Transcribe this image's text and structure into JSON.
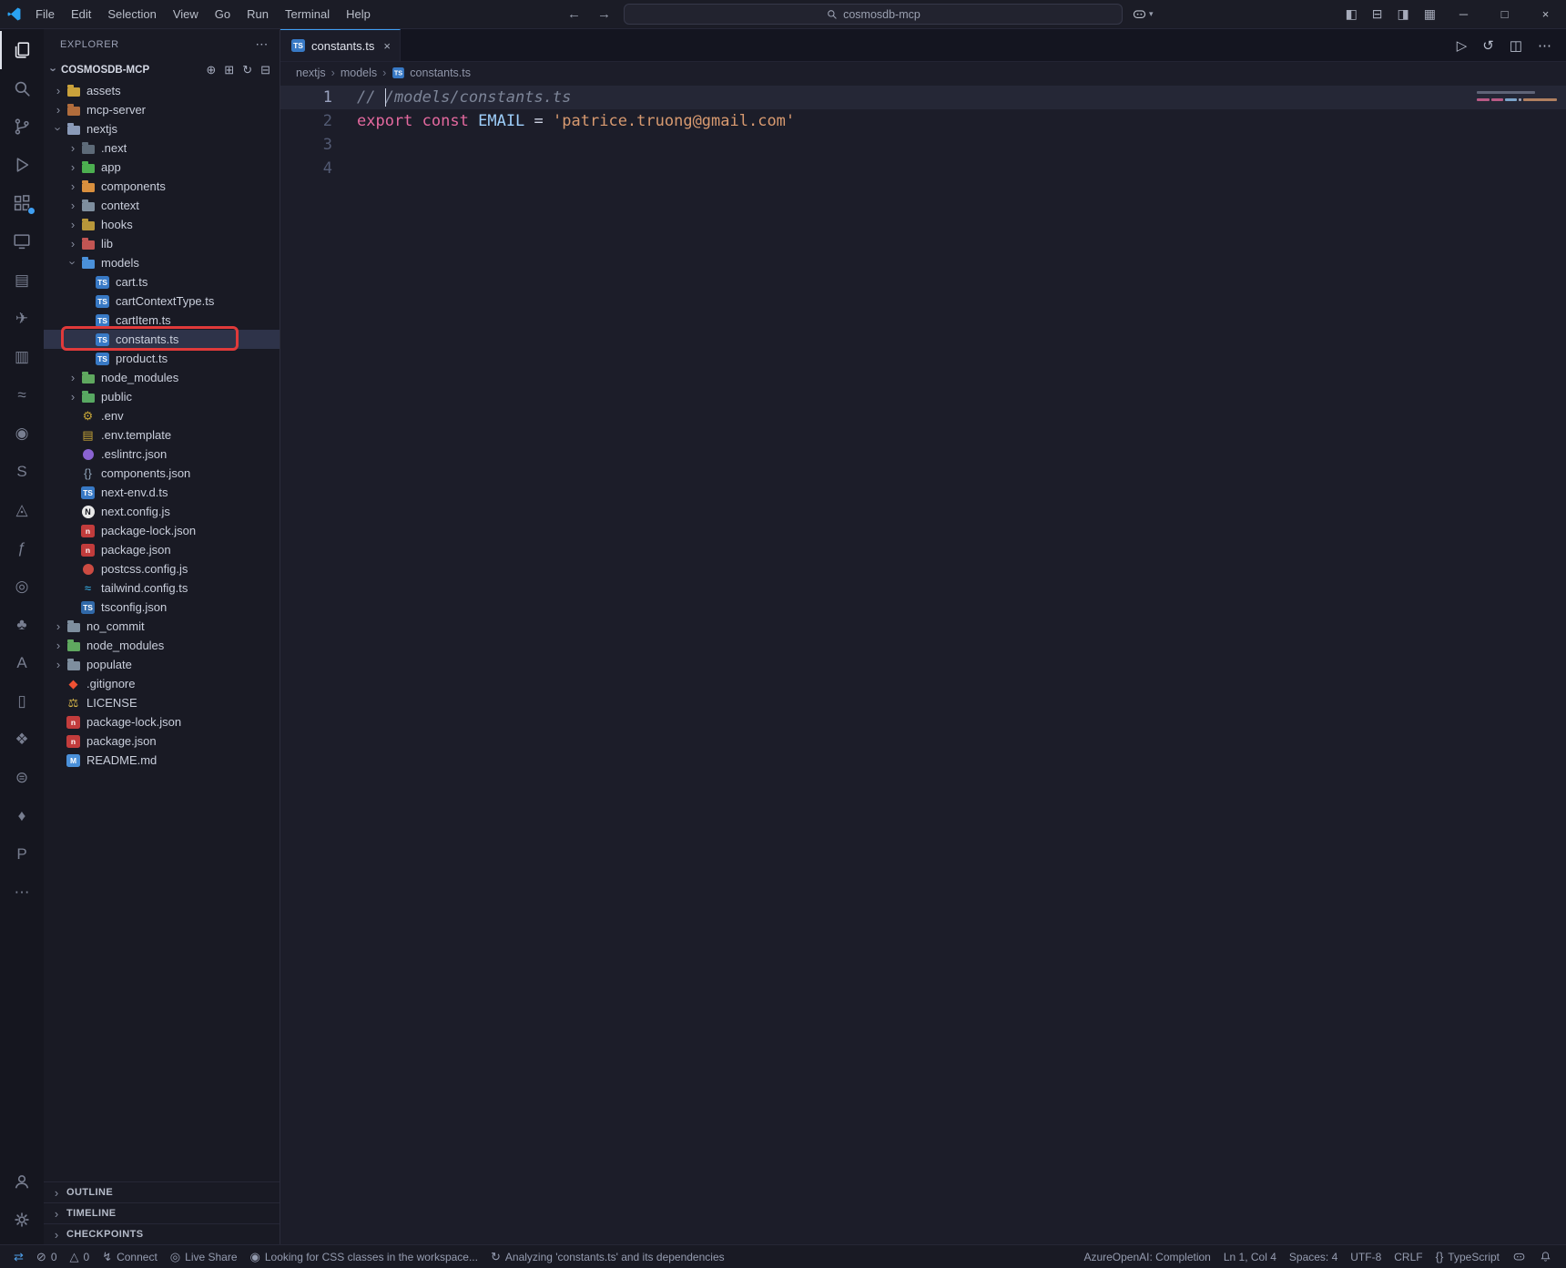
{
  "titlebar": {
    "menus": [
      "File",
      "Edit",
      "Selection",
      "View",
      "Go",
      "Run",
      "Terminal",
      "Help"
    ],
    "nav": {
      "back": "←",
      "forward": "→"
    },
    "search_value": "cosmosdb-mcp",
    "layout_icons": [
      {
        "name": "toggle-primary-sidebar",
        "glyph": "◧"
      },
      {
        "name": "toggle-panel",
        "glyph": "⊟"
      },
      {
        "name": "toggle-secondary-sidebar",
        "glyph": "◨"
      },
      {
        "name": "customize-layout",
        "glyph": "▦"
      }
    ],
    "window_controls": [
      {
        "name": "minimize",
        "glyph": "─"
      },
      {
        "name": "maximize",
        "glyph": "□"
      },
      {
        "name": "close",
        "glyph": "×"
      }
    ]
  },
  "activity_bar": {
    "top": [
      {
        "name": "explorer",
        "active": true
      },
      {
        "name": "search"
      },
      {
        "name": "source-control"
      },
      {
        "name": "run-and-debug"
      },
      {
        "name": "extensions",
        "badge": true
      },
      {
        "name": "remote-explorer"
      },
      {
        "name": "open-editors",
        "glyph": "▤"
      },
      {
        "name": "thunder-client",
        "glyph": "✈"
      },
      {
        "name": "testing",
        "glyph": "▥"
      },
      {
        "name": "docker",
        "glyph": "≈"
      },
      {
        "name": "github",
        "glyph": "◉"
      },
      {
        "name": "snyk-security",
        "glyph": "S"
      },
      {
        "name": "azure-pipelines",
        "glyph": "◬"
      },
      {
        "name": "azure-functions",
        "glyph": "ƒ"
      },
      {
        "name": "nx-console",
        "glyph": "◎"
      },
      {
        "name": "mongodb",
        "glyph": "♣"
      },
      {
        "name": "azure",
        "glyph": "A"
      },
      {
        "name": "docs",
        "glyph": "▯"
      },
      {
        "name": "security",
        "glyph": "❖"
      },
      {
        "name": "database",
        "glyph": "⊜"
      },
      {
        "name": "bookmarks",
        "glyph": "♦"
      },
      {
        "name": "python",
        "glyph": "P"
      },
      {
        "name": "additional-views",
        "glyph": "⋯"
      }
    ],
    "bottom": [
      {
        "name": "accounts"
      },
      {
        "name": "manage-settings"
      }
    ]
  },
  "explorer": {
    "title": "EXPLORER",
    "header_more": "⋯",
    "section": "COSMOSDB-MCP",
    "section_actions": [
      {
        "name": "new-file",
        "glyph": "⊕"
      },
      {
        "name": "new-folder",
        "glyph": "⊞"
      },
      {
        "name": "refresh-explorer",
        "glyph": "↻"
      },
      {
        "name": "collapse-folders",
        "glyph": "⊟"
      }
    ],
    "tree": [
      {
        "label": "assets",
        "depth": 0,
        "chevron": "right",
        "icon": "folder-assets"
      },
      {
        "label": "mcp-server",
        "depth": 0,
        "chevron": "right",
        "icon": "folder-mcp"
      },
      {
        "label": "nextjs",
        "depth": 0,
        "chevron": "down",
        "icon": "folder-open"
      },
      {
        "label": ".next",
        "depth": 1,
        "chevron": "right",
        "icon": "folder-next"
      },
      {
        "label": "app",
        "depth": 1,
        "chevron": "right",
        "icon": "folder-app"
      },
      {
        "label": "components",
        "depth": 1,
        "chevron": "right",
        "icon": "folder-components"
      },
      {
        "label": "context",
        "depth": 1,
        "chevron": "right",
        "icon": "folder-context"
      },
      {
        "label": "hooks",
        "depth": 1,
        "chevron": "right",
        "icon": "folder-hooks"
      },
      {
        "label": "lib",
        "depth": 1,
        "chevron": "right",
        "icon": "folder-lib"
      },
      {
        "label": "models",
        "depth": 1,
        "chevron": "down",
        "icon": "folder-models"
      },
      {
        "label": "cart.ts",
        "depth": 2,
        "icon": "ts"
      },
      {
        "label": "cartContextType.ts",
        "depth": 2,
        "icon": "ts"
      },
      {
        "label": "cartItem.ts",
        "depth": 2,
        "icon": "ts"
      },
      {
        "label": "constants.ts",
        "depth": 2,
        "icon": "ts",
        "selected": true,
        "annotated": true
      },
      {
        "label": "product.ts",
        "depth": 2,
        "icon": "ts"
      },
      {
        "label": "node_modules",
        "depth": 1,
        "chevron": "right",
        "icon": "folder-node-modules"
      },
      {
        "label": "public",
        "depth": 1,
        "chevron": "right",
        "icon": "folder-public"
      },
      {
        "label": ".env",
        "depth": 1,
        "icon": "gear"
      },
      {
        "label": ".env.template",
        "depth": 1,
        "icon": "env-template"
      },
      {
        "label": ".eslintrc.json",
        "depth": 1,
        "icon": "eslint"
      },
      {
        "label": "components.json",
        "depth": 1,
        "icon": "braces"
      },
      {
        "label": "next-env.d.ts",
        "depth": 1,
        "icon": "ts"
      },
      {
        "label": "next.config.js",
        "depth": 1,
        "icon": "next"
      },
      {
        "label": "package-lock.json",
        "depth": 1,
        "icon": "npm"
      },
      {
        "label": "package.json",
        "depth": 1,
        "icon": "npm"
      },
      {
        "label": "postcss.config.js",
        "depth": 1,
        "icon": "postcss"
      },
      {
        "label": "tailwind.config.ts",
        "depth": 1,
        "icon": "tailwind"
      },
      {
        "label": "tsconfig.json",
        "depth": 1,
        "icon": "tsconfig"
      },
      {
        "label": "no_commit",
        "depth": 0,
        "chevron": "right",
        "icon": "folder"
      },
      {
        "label": "node_modules",
        "depth": 0,
        "chevron": "right",
        "icon": "folder-node-modules"
      },
      {
        "label": "populate",
        "depth": 0,
        "chevron": "right",
        "icon": "folder"
      },
      {
        "label": ".gitignore",
        "depth": 0,
        "icon": "git"
      },
      {
        "label": "LICENSE",
        "depth": 0,
        "icon": "license"
      },
      {
        "label": "package-lock.json",
        "depth": 0,
        "icon": "npm"
      },
      {
        "label": "package.json",
        "depth": 0,
        "icon": "npm"
      },
      {
        "label": "README.md",
        "depth": 0,
        "icon": "readme"
      }
    ],
    "panels": [
      {
        "label": "OUTLINE"
      },
      {
        "label": "TIMELINE"
      },
      {
        "label": "CHECKPOINTS"
      }
    ]
  },
  "editor": {
    "tab": {
      "label": "constants.ts",
      "icon": "ts"
    },
    "actions": [
      {
        "name": "run-file",
        "glyph": "▷"
      },
      {
        "name": "timeline-history",
        "glyph": "↺"
      },
      {
        "name": "split-editor",
        "glyph": "◫"
      },
      {
        "name": "more-actions",
        "glyph": "⋯"
      }
    ],
    "breadcrumb": [
      {
        "label": "nextjs"
      },
      {
        "label": "models"
      },
      {
        "label": "constants.ts",
        "icon": "ts"
      }
    ],
    "lines": [
      {
        "num": "1",
        "current": true,
        "tokens": [
          {
            "t": "// /models/constants.ts",
            "c": "comment"
          }
        ]
      },
      {
        "num": "2",
        "tokens": [
          {
            "t": "export",
            "c": "keyword"
          },
          {
            "t": " ",
            "c": "plain"
          },
          {
            "t": "const",
            "c": "keyword"
          },
          {
            "t": " ",
            "c": "plain"
          },
          {
            "t": "EMAIL",
            "c": "constant"
          },
          {
            "t": " ",
            "c": "plain"
          },
          {
            "t": "=",
            "c": "operator"
          },
          {
            "t": " ",
            "c": "plain"
          },
          {
            "t": "'patrice.truong@gmail.com'",
            "c": "string"
          }
        ]
      },
      {
        "num": "3",
        "tokens": []
      },
      {
        "num": "4",
        "tokens": []
      }
    ]
  },
  "status_bar": {
    "left": [
      {
        "name": "remote-indicator",
        "glyph": "⇄",
        "label": "",
        "accent": true
      },
      {
        "name": "problems-errors",
        "glyph": "⊘",
        "label": "0"
      },
      {
        "name": "problems-warnings",
        "glyph": "△",
        "label": "0"
      },
      {
        "name": "connect",
        "glyph": "↯",
        "label": "Connect"
      },
      {
        "name": "live-share",
        "glyph": "◎",
        "label": "Live Share"
      },
      {
        "name": "css-workspace-status",
        "glyph": "◉",
        "label": "Looking for CSS classes in the workspace..."
      },
      {
        "name": "analyzing-status",
        "glyph": "↻",
        "label": "Analyzing 'constants.ts' and its dependencies"
      }
    ],
    "right": [
      {
        "name": "azure-openai-completion",
        "label": "AzureOpenAI: Completion"
      },
      {
        "name": "cursor-position",
        "label": "Ln 1, Col 4"
      },
      {
        "name": "indentation",
        "label": "Spaces: 4"
      },
      {
        "name": "encoding",
        "label": "UTF-8"
      },
      {
        "name": "eol-sequence",
        "label": "CRLF"
      },
      {
        "name": "language-mode",
        "glyph": "{}",
        "label": "TypeScript"
      },
      {
        "name": "copilot-status",
        "svg": "copilot",
        "label": ""
      },
      {
        "name": "notifications",
        "svg": "bell",
        "label": ""
      }
    ]
  }
}
